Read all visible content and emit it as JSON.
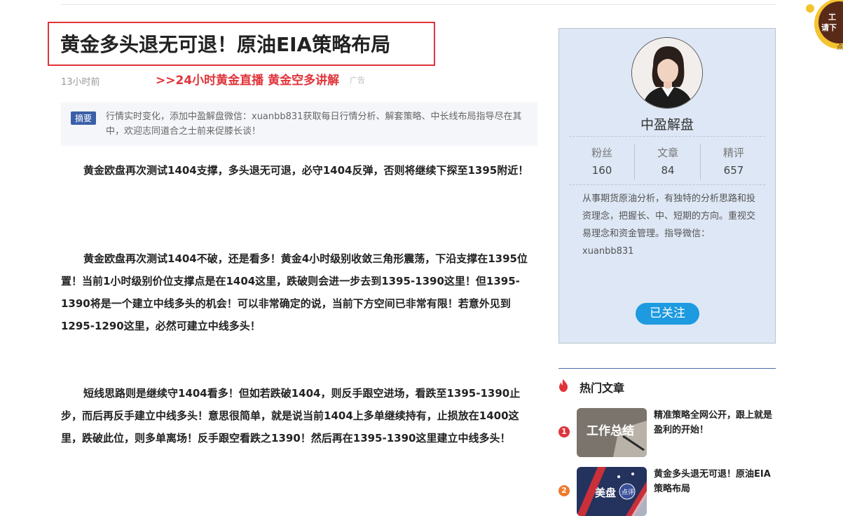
{
  "article": {
    "title": "黄金多头退无可退！原油EIA策略布局",
    "time": "13小时前",
    "promo": ">>24小时黄金直播 黄金空多讲解",
    "ad_label": "广告",
    "summary_badge": "摘要",
    "summary": "行情实时变化，添加中盈解盘微信：xuanbb831获取每日行情分析、解套策略、中长线布局指导尽在其中，欢迎志同道合之士前来促膝长谈！",
    "paragraphs": [
      "黄金欧盘再次测试1404支撑，多头退无可退，必守1404反弹，否则将继续下探至1395附近！",
      "黄金欧盘再次测试1404不破，还是看多！黄金4小时级别收敛三角形震荡，下沿支撑在1395位置！当前1小时级别价位支撑点是在1404这里，跌破则会进一步去到1395-1390这里！但1395-1390将是一个建立中线多头的机会！可以非常确定的说，当前下方空间已非常有限！若意外见到1295-1290这里，必然可建立中线多头！",
      "短线思路则是继续守1404看多！但如若跌破1404，则反手跟空进场，看跌至1395-1390止步，而后再反手建立中线多头！意思很简单，就是说当前1404上多单继续持有，止损放在1400这里，跌破此位，则多单离场！反手跟空看跌之1390！然后再在1395-1390这里建立中线多头！"
    ]
  },
  "author": {
    "name": "中盈解盘",
    "stats": [
      {
        "label": "粉丝",
        "value": "160"
      },
      {
        "label": "文章",
        "value": "84"
      },
      {
        "label": "精评",
        "value": "657"
      }
    ],
    "bio": "从事期货原油分析，有独特的分析思路和投资理念，把握长、中、短期的方向。重视交易理念和资金管理。指导微信：xuanbb831",
    "follow_label": "已关注"
  },
  "hot": {
    "title": "热门文章",
    "items": [
      {
        "rank": "1",
        "text": "精准策略全网公开，跟上就是盈利的开始！",
        "thumb_caption": "工作总结",
        "color": "#e0343a"
      },
      {
        "rank": "2",
        "text": "黄金多头退无可退！原油EIA策略布局",
        "thumb_caption": "美盘",
        "thumb_caption2": "点评",
        "color": "#f07a2a"
      }
    ]
  },
  "corner": {
    "line1": "工",
    "line2": "请下",
    "line3": "点"
  }
}
